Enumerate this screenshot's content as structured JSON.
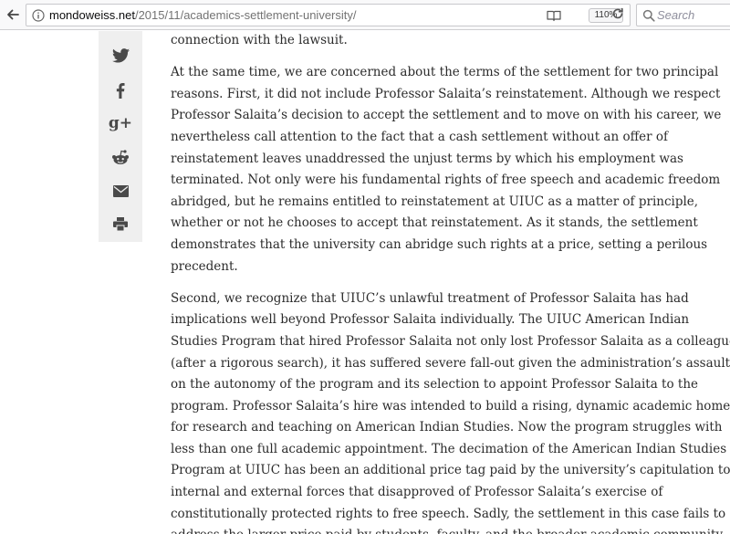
{
  "browser": {
    "url_host": "mondoweiss.net",
    "url_path": "/2015/11/academics-settlement-university/",
    "zoom": "110%",
    "search_placeholder": "Search",
    "icons": {
      "back": "back-arrow-icon",
      "info": "info-icon",
      "reader": "reader-view-icon",
      "reload": "reload-icon",
      "search": "search-icon"
    }
  },
  "share": {
    "items": [
      {
        "name": "twitter",
        "icon": "twitter-icon"
      },
      {
        "name": "facebook",
        "icon": "facebook-icon",
        "glyph": "f"
      },
      {
        "name": "google-plus",
        "icon": "google-plus-icon",
        "glyph": "g+"
      },
      {
        "name": "reddit",
        "icon": "reddit-icon"
      },
      {
        "name": "email",
        "icon": "email-icon"
      },
      {
        "name": "print",
        "icon": "print-icon"
      }
    ],
    "background": "#efefef",
    "icon_color": "#4a4a4a"
  },
  "article": {
    "p0": [
      "connection with the lawsuit."
    ],
    "p1": [
      "At the same time, we are concerned about the terms of the settlement for two principal",
      "reasons. First, it did not include Professor Salaita’s reinstatement. Although we respect",
      "Professor Salaita’s decision to accept the settlement and to move on with his career, we",
      "nevertheless call attention to the fact that a cash settlement without an offer of",
      "reinstatement leaves unaddressed the unjust terms by which his employment was",
      "terminated. Not only were his fundamental rights of free speech and academic freedom",
      "abridged, but he remains entitled to reinstatement at UIUC as a matter of principle,",
      "whether or not he chooses to accept that reinstatement. As it stands, the settlement",
      "demonstrates that the university can abridge such rights at a price, setting a perilous",
      "precedent."
    ],
    "p2": [
      "Second, we recognize that UIUC’s unlawful treatment of Professor Salaita has had",
      "implications well beyond Professor Salaita individually. The UIUC American Indian",
      "Studies Program that hired Professor Salaita not only lost Professor Salaita as a colleague",
      "(after a rigorous search), it has suffered severe fall-out given the administration’s assault",
      "on the autonomy of the program and its selection to appoint Professor Salaita to the",
      "program. Professor Salaita’s hire was intended to build a rising, dynamic academic home",
      "for research and teaching on American Indian Studies. Now the program struggles with",
      "less than one full academic appointment. The decimation of the American Indian Studies",
      "Program at UIUC has been an additional price tag paid by the university’s capitulation to",
      "internal and external forces that disapproved of Professor Salaita’s exercise of",
      "constitutionally protected rights to free speech. Sadly, the settlement in this case fails to",
      "address the larger price paid by students, faculty, and the broader academic community"
    ]
  }
}
